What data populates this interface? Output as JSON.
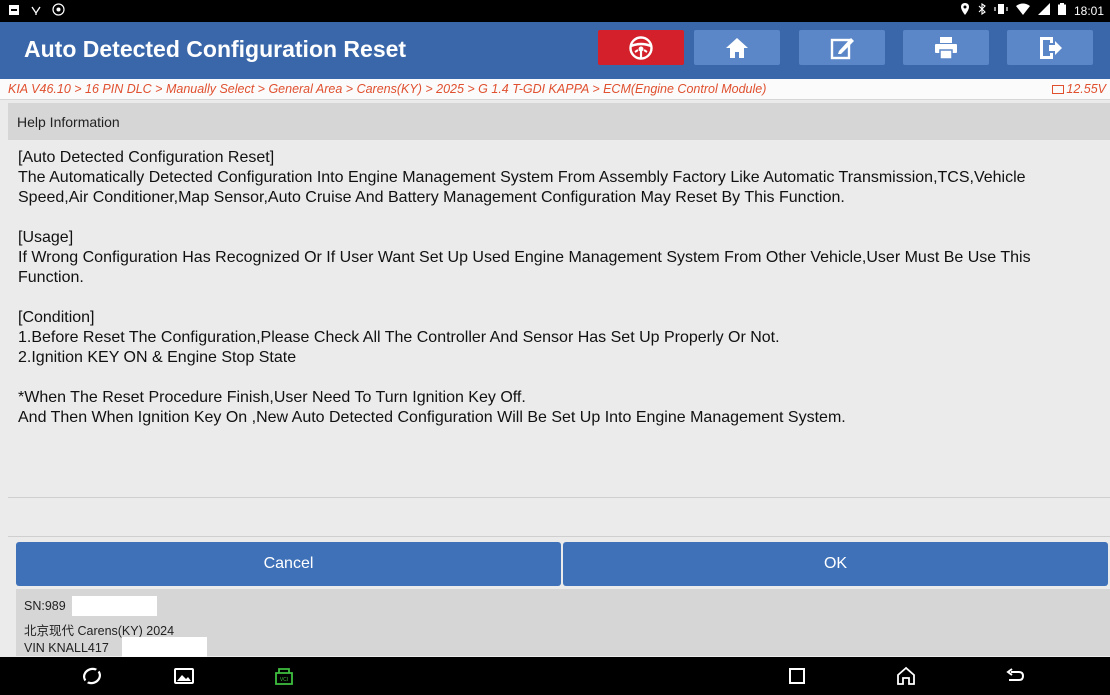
{
  "status_bar": {
    "time": "18:01",
    "left_icons": [
      "notification-icon",
      "usb-icon",
      "record-icon"
    ],
    "right_icons": [
      "location-icon",
      "bluetooth-icon",
      "vibrate-icon",
      "wifi-icon",
      "signal-icon",
      "battery-icon"
    ]
  },
  "header": {
    "title": "Auto Detected Configuration Reset",
    "buttons": [
      {
        "name": "steering-wheel-icon",
        "color": "#d4202a"
      },
      {
        "name": "home-icon"
      },
      {
        "name": "edit-icon"
      },
      {
        "name": "print-icon"
      },
      {
        "name": "exit-icon"
      }
    ]
  },
  "breadcrumb": {
    "path": "KIA V46.10 > 16 PIN DLC > Manually Select > General Area > Carens(KY) > 2025 > G 1.4 T-GDI KAPPA > ECM(Engine Control Module)",
    "voltage": "12.55V"
  },
  "section": {
    "title": "Help Information"
  },
  "help": {
    "p1_title": "[Auto Detected Configuration Reset]",
    "p1_body": "The Automatically Detected Configuration Into Engine Management System From Assembly Factory Like Automatic Transmission,TCS,Vehicle Speed,Air Conditioner,Map Sensor,Auto Cruise And Battery Management Configuration May Reset By This Function.",
    "p2_title": "[Usage]",
    "p2_body": "If Wrong Configuration Has Recognized Or If User Want Set Up Used Engine Management System From Other Vehicle,User Must Be Use This Function.",
    "p3_title": "[Condition]",
    "p3_line1": "1.Before Reset The Configuration,Please Check All The Controller And Sensor Has Set Up Properly Or Not.",
    "p3_line2": "2.Ignition KEY ON & Engine Stop State",
    "p4_line1": "*When The Reset Procedure Finish,User Need To Turn Ignition Key Off.",
    "p4_line2": "And Then When Ignition Key On ,New Auto Detected Configuration Will Be Set Up Into Engine Management System."
  },
  "actions": {
    "cancel": "Cancel",
    "ok": "OK"
  },
  "footer": {
    "sn": "SN:989",
    "vehicle": "北京现代 Carens(KY) 2024",
    "vin": "VIN KNALL417"
  },
  "colors": {
    "header_bg": "#3a67a9",
    "accent_red": "#d4202a",
    "breadcrumb_text": "#e0502f",
    "button_bg": "#3f71b8"
  }
}
